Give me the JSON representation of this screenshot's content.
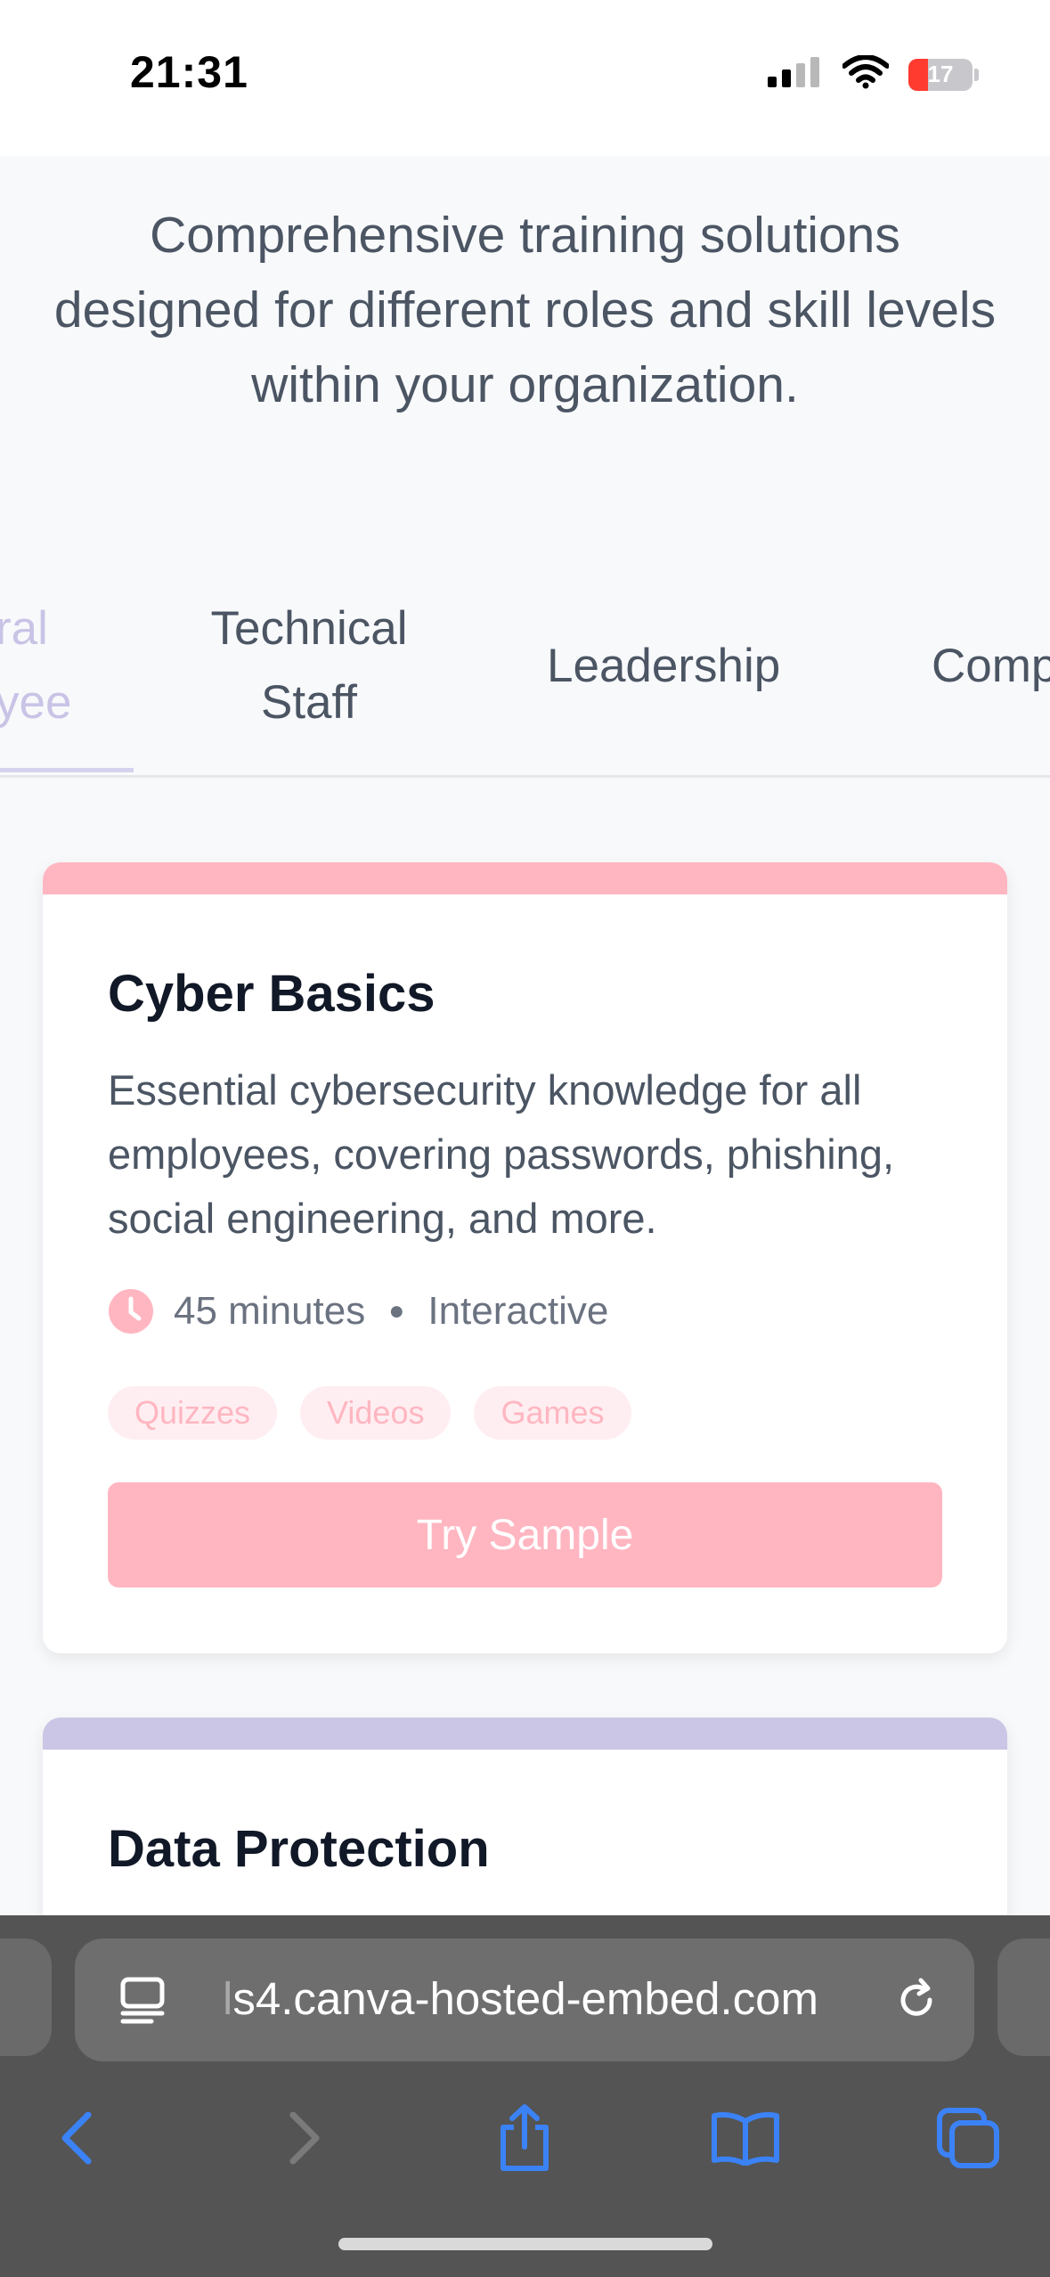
{
  "status_bar": {
    "time": "21:31",
    "battery_level": "17",
    "icons": [
      "signal-icon",
      "wifi-icon",
      "battery-icon"
    ]
  },
  "hero": {
    "description": "Comprehensive training solutions designed for different roles and skill levels within your organization."
  },
  "tabs": [
    {
      "line1": "ral",
      "line2": "yee",
      "active": true
    },
    {
      "line1": "Technical",
      "line2": "Staff"
    },
    {
      "label": "Leadership"
    },
    {
      "label": "Comp"
    }
  ],
  "cards": [
    {
      "title": "Cyber Basics",
      "description": "Essential cybersecurity knowledge for all employees, covering passwords, phishing, social engineering, and more.",
      "duration": "45 minutes",
      "format": "Interactive",
      "tags": [
        "Quizzes",
        "Videos",
        "Games"
      ],
      "cta_label": "Try Sample",
      "accent": "#ffb6c1"
    },
    {
      "title": "Data Protection",
      "accent": "#cbc5e6"
    }
  ],
  "browser": {
    "url_prefix": "l",
    "url": "s4.canva-hosted-embed.com",
    "toolbar": [
      "back-icon",
      "forward-icon",
      "share-icon",
      "bookmarks-icon",
      "tabs-icon"
    ]
  },
  "colors": {
    "accent_pink": "#ffb6c1",
    "accent_lavender": "#cbc5e6",
    "ios_blue": "#3b82f6"
  }
}
